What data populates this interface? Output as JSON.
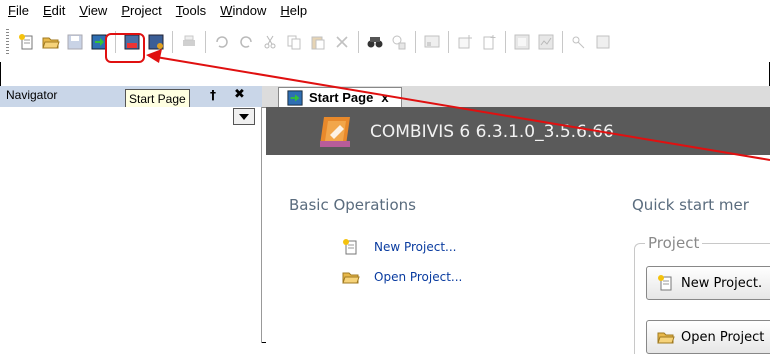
{
  "menu": [
    {
      "id": "file",
      "mnemonic": "F",
      "rest": "ile"
    },
    {
      "id": "edit",
      "mnemonic": "E",
      "rest": "dit"
    },
    {
      "id": "view",
      "mnemonic": "V",
      "rest": "iew"
    },
    {
      "id": "project",
      "mnemonic": "P",
      "rest": "roject"
    },
    {
      "id": "tools",
      "mnemonic": "T",
      "rest": "ools"
    },
    {
      "id": "window",
      "mnemonic": "W",
      "rest": "indow"
    },
    {
      "id": "help",
      "mnemonic": "H",
      "rest": "elp"
    }
  ],
  "navigator": {
    "title": "Navigator",
    "pin": "†",
    "close": "✖"
  },
  "tooltip": "Start Page",
  "tab": {
    "label": "Start Page",
    "close": "x"
  },
  "banner": {
    "product": "COMBIVIS 6 6.3.1.0_3.5.6.66"
  },
  "basic_operations": {
    "title": "Basic Operations",
    "links": [
      {
        "label": "New Project..."
      },
      {
        "label": "Open Project..."
      }
    ]
  },
  "quick_start": {
    "title": "Quick start mer",
    "group": "Project",
    "buttons": [
      {
        "label": "New Project."
      },
      {
        "label": "Open Project"
      }
    ]
  },
  "colors": {
    "highlight": "#e01010",
    "banner": "#5a5a5a",
    "link": "#0a3ca0"
  }
}
